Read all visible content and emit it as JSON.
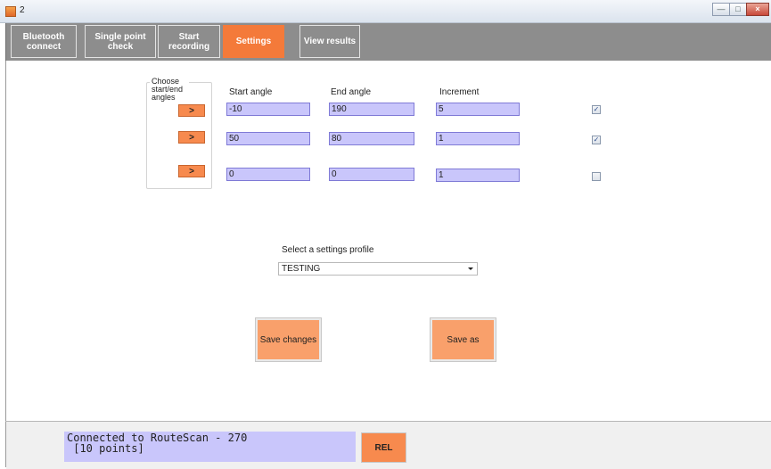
{
  "window": {
    "title": "2",
    "minimize_glyph": "—",
    "maximize_glyph": "□",
    "close_glyph": "×"
  },
  "tabs": [
    {
      "label": "Bluetooth\nconnect",
      "active": false
    },
    {
      "label": "Single point\ncheck",
      "active": false
    },
    {
      "label": "Start\nrecording",
      "active": false
    },
    {
      "label": "Settings",
      "active": true
    },
    {
      "label": "View results",
      "active": false
    }
  ],
  "angles": {
    "group_label": "Choose\nstart/end\nangles",
    "arrow_glyph": ">",
    "headers": {
      "start": "Start angle",
      "end": "End angle",
      "increment": "Increment"
    },
    "rows": [
      {
        "start": "-10",
        "end": "190",
        "increment": "5",
        "checked": true,
        "check_glyph": "✓"
      },
      {
        "start": "50",
        "end": "80",
        "increment": "1",
        "checked": true,
        "check_glyph": "✓"
      },
      {
        "start": "0",
        "end": "0",
        "increment": "1",
        "checked": false,
        "check_glyph": ""
      }
    ]
  },
  "profile": {
    "label": "Select a settings profile",
    "selected": "TESTING"
  },
  "actions": {
    "save_changes": "Save changes",
    "save_as": "Save as"
  },
  "status": {
    "line1": "Connected to RouteScan - 270",
    "line2": " [10 points]",
    "rel_label": "REL"
  },
  "colors": {
    "accent_orange": "#f47a3a",
    "button_orange": "#f78a4e",
    "field_lavender": "#c9c6fb",
    "tabbar_gray": "#8d8d8d"
  }
}
